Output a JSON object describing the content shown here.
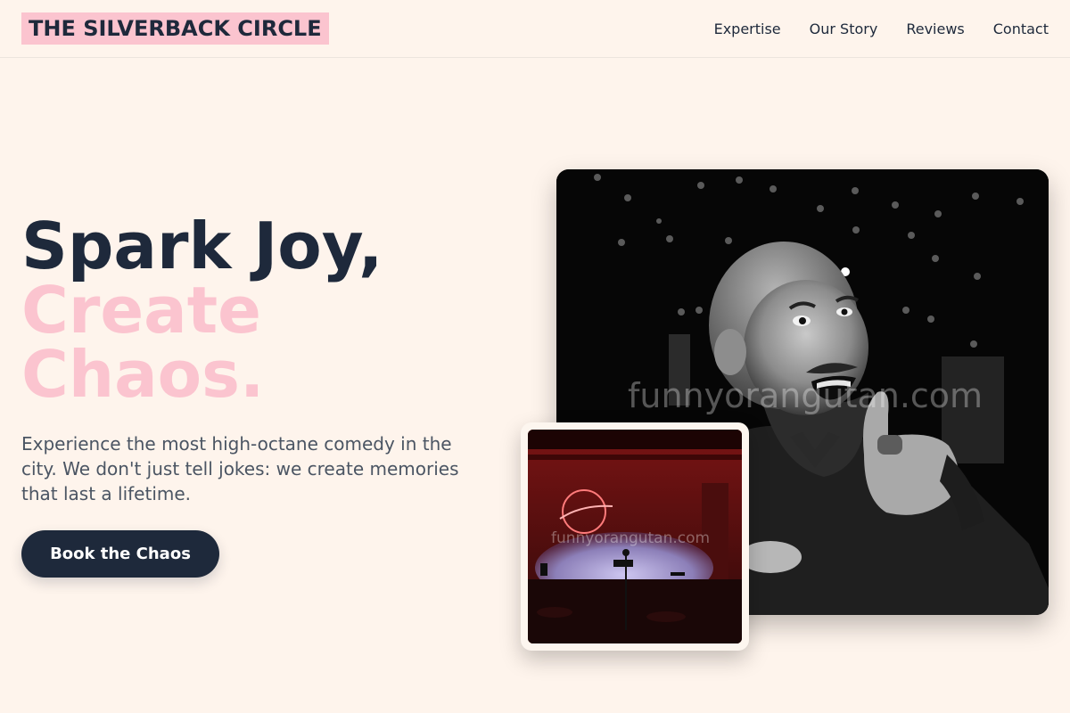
{
  "header": {
    "brand": "THE SILVERBACK CIRCLE",
    "nav": [
      "Expertise",
      "Our Story",
      "Reviews",
      "Contact"
    ]
  },
  "hero": {
    "line1": "Spark Joy,",
    "line2": "Create",
    "line3": "Chaos.",
    "lead": "Experience the most high-octane comedy in the city. We don't just tell jokes: we create memories that last a lifetime.",
    "cta": "Book the Chaos"
  },
  "images": {
    "main_watermark": "funnyorangutan.com",
    "small_watermark": "funnyorangutan.com"
  },
  "colors": {
    "background": "#fef4ec",
    "navy": "#1e293b",
    "pink": "#fbc4cf"
  }
}
